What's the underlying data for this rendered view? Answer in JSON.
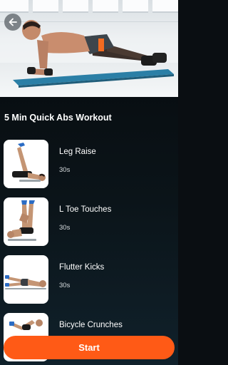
{
  "header": {
    "back_icon": "arrow-left-icon"
  },
  "workout": {
    "title": "5 Min Quick Abs Workout"
  },
  "exercises": [
    {
      "name": "Leg Raise",
      "duration": "30s"
    },
    {
      "name": "L Toe Touches",
      "duration": "30s"
    },
    {
      "name": "Flutter Kicks",
      "duration": "30s"
    },
    {
      "name": "Bicycle Crunches",
      "duration": ""
    }
  ],
  "actions": {
    "start_label": "Start"
  },
  "colors": {
    "accent": "#ff5a16",
    "background": "#0a0e12",
    "text": "#ffffff"
  }
}
